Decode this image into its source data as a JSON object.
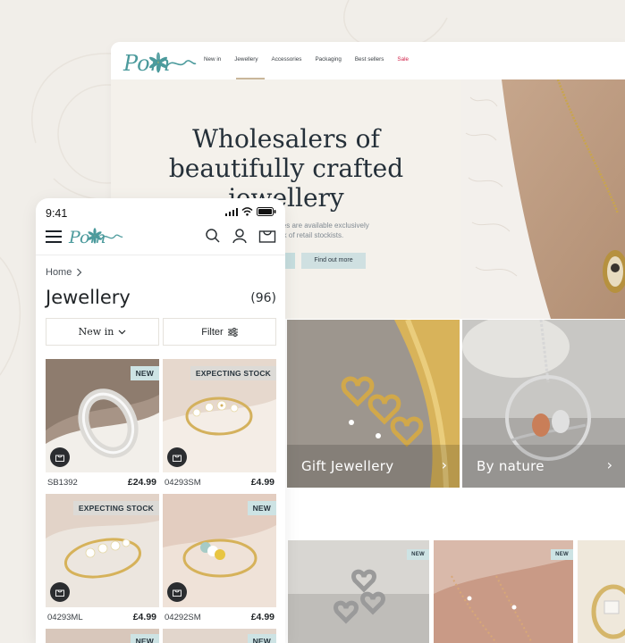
{
  "desktop": {
    "logo_text": "Pom",
    "nav": [
      "New in",
      "Jewellery",
      "Accessories",
      "Packaging",
      "Best sellers",
      "Sale"
    ],
    "hero": {
      "title_lines": [
        "Wholesalers of",
        "beautifully crafted",
        "jewellery"
      ],
      "subtitle_lines": [
        "ies are available exclusively",
        "rk of retail stockists."
      ],
      "secondary_button": "Find out more"
    },
    "categories": [
      {
        "label": "Gift Jewellery"
      },
      {
        "label": "By nature"
      }
    ],
    "product_badges": [
      "NEW",
      "NEW"
    ]
  },
  "mobile": {
    "time": "9:41",
    "logo_text": "Pom",
    "breadcrumb": "Home",
    "title": "Jewellery",
    "count": "(96)",
    "sort_label": "New in",
    "filter_label": "Filter",
    "products": [
      {
        "badge": "NEW",
        "sku": "SB1392",
        "price": "£24.99"
      },
      {
        "badge": "EXPECTING STOCK",
        "sku": "04293SM",
        "price": "£4.99"
      },
      {
        "badge": "EXPECTING STOCK",
        "sku": "04293ML",
        "price": "£4.99"
      },
      {
        "badge": "NEW",
        "sku": "04292SM",
        "price": "£4.99"
      }
    ],
    "next_row_badges": [
      "NEW",
      "NEW"
    ]
  },
  "colors": {
    "background": "#f1eee9",
    "teal_logo": "#4b9a9c",
    "badge_new": "#cde3e4",
    "badge_stock": "#dcdad6",
    "sale_red": "#d1224a",
    "button": "#cfe0e1"
  }
}
